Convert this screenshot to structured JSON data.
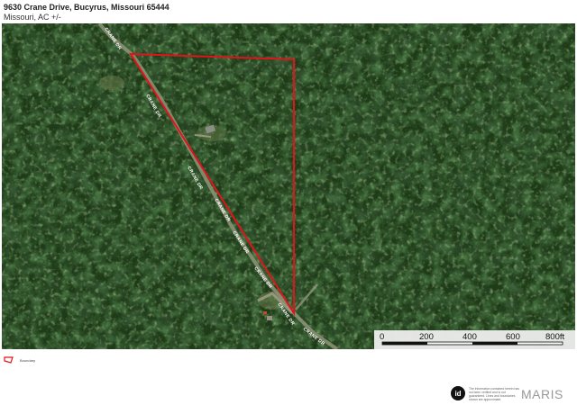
{
  "header": {
    "title": "9630 Crane Drive, Bucyrus, Missouri 65444",
    "subtitle": "Missouri,  AC +/-"
  },
  "map": {
    "boundary_color": "#e0141b",
    "road_labels": [
      "CRANE DR",
      "CRANE DR",
      "CRANE DR",
      "CRANE DR",
      "CRANE DR",
      "CRANE DR",
      "CRANE DR"
    ]
  },
  "scale_bar": {
    "labels": [
      "0",
      "200",
      "400",
      "600",
      "800ft"
    ]
  },
  "legend": {
    "label": "Boundary"
  },
  "footer": {
    "badge": "id",
    "disclaimer": "The information contained herein has not been verified and is not guaranteed. Lines and boundaries shown are approximate.",
    "brand": "MARIS"
  }
}
